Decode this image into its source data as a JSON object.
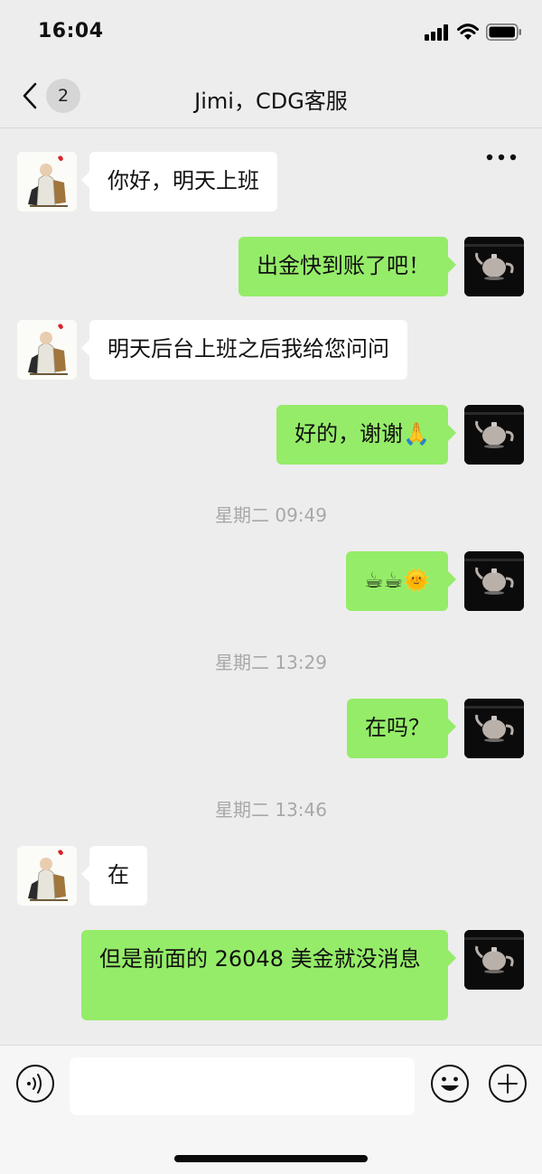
{
  "status_bar": {
    "time": "16:04"
  },
  "nav": {
    "back_count": "2",
    "title": "Jimi，CDG客服"
  },
  "messages": [
    {
      "side": "left",
      "text": "你好，明天上班"
    },
    {
      "side": "right",
      "text": "出金快到账了吧！"
    },
    {
      "side": "left",
      "text": "明天后台上班之后我给您问问"
    },
    {
      "side": "right",
      "text": "好的，谢谢🙏"
    },
    {
      "timestamp": "星期二 09:49"
    },
    {
      "side": "right",
      "text": "☕☕🌞"
    },
    {
      "timestamp": "星期二 13:29"
    },
    {
      "side": "right",
      "text": "在吗？"
    },
    {
      "timestamp": "星期二 13:46"
    },
    {
      "side": "left",
      "text": "在"
    },
    {
      "side": "right",
      "text": "但是前面的 26048 美金就没消息"
    }
  ],
  "colors": {
    "background": "#ededed",
    "my_bubble": "#95ec69",
    "their_bubble": "#ffffff"
  },
  "icons": [
    "back-chevron-icon",
    "more-icon",
    "voice-icon",
    "emoji-icon",
    "plus-icon"
  ]
}
